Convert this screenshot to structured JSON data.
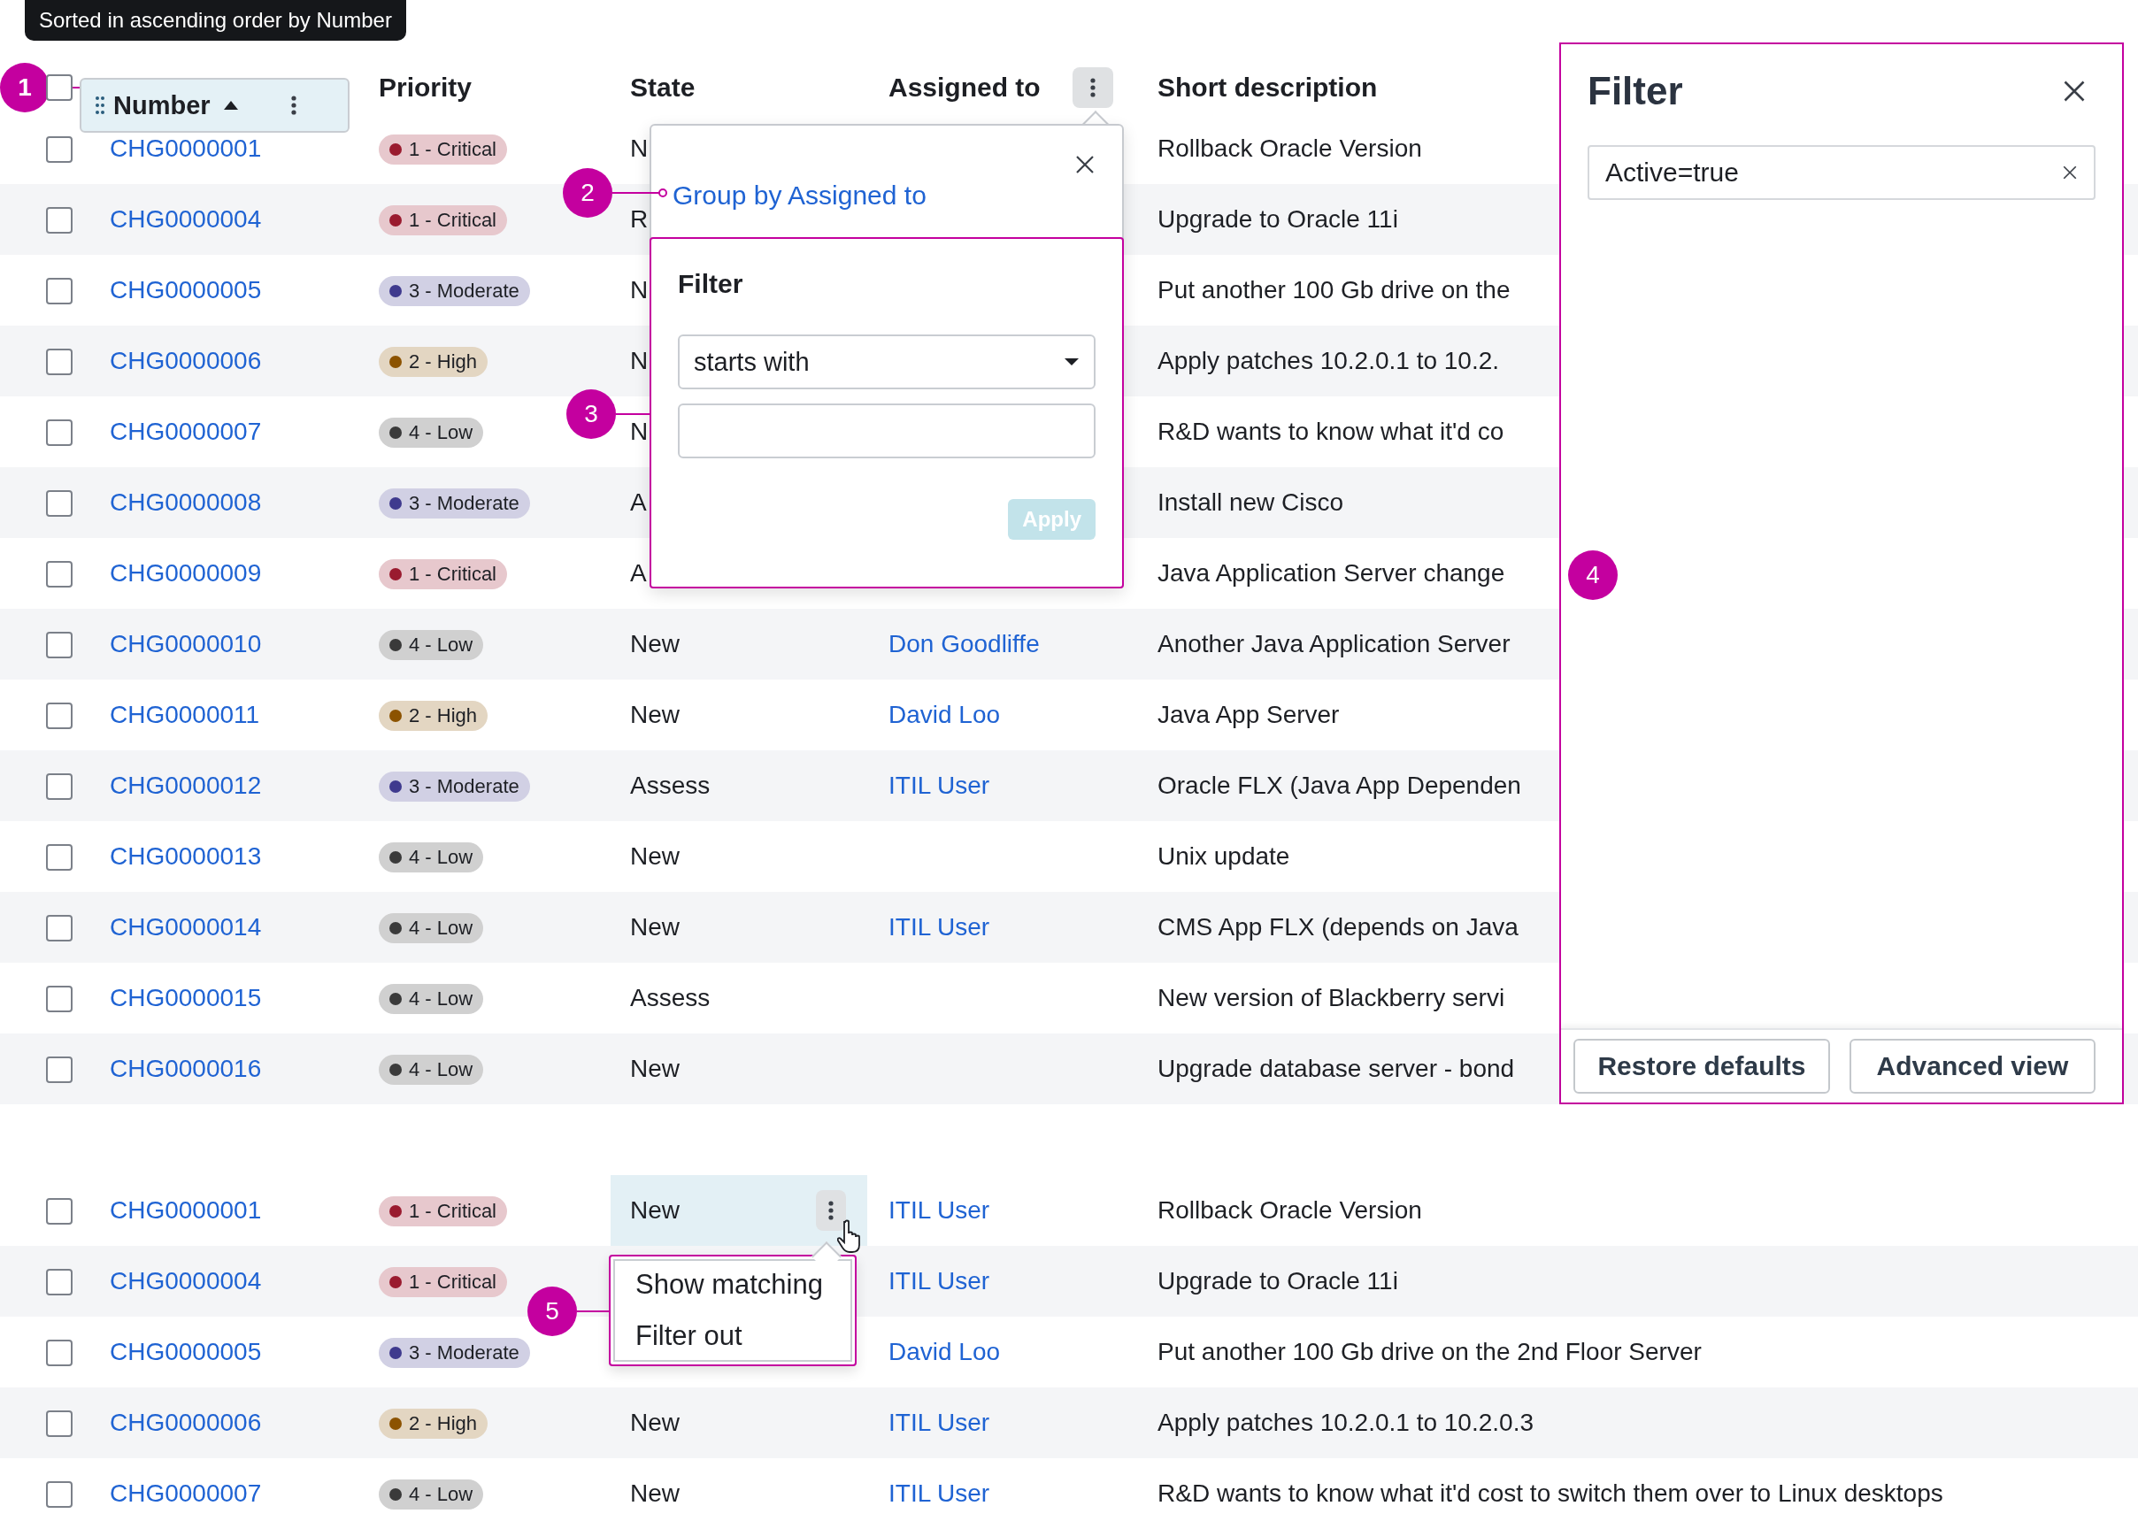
{
  "tooltip": "Sorted in ascending order by Number",
  "header": {
    "checked": false,
    "columns": [
      {
        "label": "Number",
        "selected": true,
        "sort_ascending": true,
        "menu_open": false,
        "annotation": "1"
      },
      {
        "label": "Priority"
      },
      {
        "label": "State"
      },
      {
        "label": "Assigned to",
        "menu_open": true
      },
      {
        "label": "Short description"
      }
    ]
  },
  "tables": [
    {
      "rows": [
        {
          "checked": false,
          "number": "CHG0000001",
          "priority": {
            "label": "1 - Critical",
            "color": "#9a1b2f"
          },
          "state": "N",
          "short_description": "Rollback Oracle Version"
        },
        {
          "checked": false,
          "number": "CHG0000004",
          "priority": {
            "label": "1 - Critical",
            "color": "#9a1b2f"
          },
          "state": "R",
          "short_description": "Upgrade to Oracle 11i"
        },
        {
          "checked": false,
          "number": "CHG0000005",
          "priority": {
            "label": "3 - Moderate",
            "color": "#3f3a8e"
          },
          "state": "N",
          "short_description": "Put another 100 Gb drive on the"
        },
        {
          "checked": false,
          "number": "CHG0000006",
          "priority": {
            "label": "2 - High",
            "color": "#8c5300"
          },
          "state": "N",
          "short_description": "Apply patches 10.2.0.1 to 10.2."
        },
        {
          "checked": false,
          "number": "CHG0000007",
          "priority": {
            "label": "4 - Low",
            "color": "#3a3a3a"
          },
          "state": "N",
          "short_description": "R&D wants to know what it'd co"
        },
        {
          "checked": false,
          "number": "CHG0000008",
          "priority": {
            "label": "3 - Moderate",
            "color": "#3f3a8e"
          },
          "state": "A",
          "short_description": "Install new Cisco"
        },
        {
          "checked": false,
          "number": "CHG0000009",
          "priority": {
            "label": "1 - Critical",
            "color": "#9a1b2f"
          },
          "state": "A",
          "short_description": "Java Application Server change"
        },
        {
          "checked": false,
          "number": "CHG0000010",
          "priority": {
            "label": "4 - Low",
            "color": "#3a3a3a"
          },
          "state": "New",
          "assigned_to": "Don Goodliffe",
          "short_description": "Another Java Application Server"
        },
        {
          "checked": false,
          "number": "CHG0000011",
          "priority": {
            "label": "2 - High",
            "color": "#8c5300"
          },
          "state": "New",
          "assigned_to": "David Loo",
          "short_description": "Java App Server"
        },
        {
          "checked": false,
          "number": "CHG0000012",
          "priority": {
            "label": "3 - Moderate",
            "color": "#3f3a8e"
          },
          "state": "Assess",
          "assigned_to": "ITIL User",
          "short_description": "Oracle FLX (Java App Dependen"
        },
        {
          "checked": false,
          "number": "CHG0000013",
          "priority": {
            "label": "4 - Low",
            "color": "#3a3a3a"
          },
          "state": "New",
          "short_description": "Unix update"
        },
        {
          "checked": false,
          "number": "CHG0000014",
          "priority": {
            "label": "4 - Low",
            "color": "#3a3a3a"
          },
          "state": "New",
          "assigned_to": "ITIL User",
          "short_description": "CMS App FLX (depends on Java"
        },
        {
          "checked": false,
          "number": "CHG0000015",
          "priority": {
            "label": "4 - Low",
            "color": "#3a3a3a"
          },
          "state": "Assess",
          "short_description": "New version of Blackberry servi"
        },
        {
          "checked": false,
          "number": "CHG0000016",
          "priority": {
            "label": "4 - Low",
            "color": "#3a3a3a"
          },
          "state": "New",
          "short_description": "Upgrade database server - bond"
        }
      ]
    },
    {
      "rows": [
        {
          "checked": false,
          "number": "CHG0000001",
          "priority": {
            "label": "1 - Critical",
            "color": "#9a1b2f"
          },
          "state": "New",
          "hovered": true,
          "assigned_to": "ITIL User",
          "short_description": "Rollback Oracle Version"
        },
        {
          "checked": false,
          "number": "CHG0000004",
          "priority": {
            "label": "1 - Critical",
            "color": "#9a1b2f"
          },
          "hovered": false,
          "assigned_to": "ITIL User",
          "short_description": "Upgrade to Oracle 11i"
        },
        {
          "checked": false,
          "number": "CHG0000005",
          "priority": {
            "label": "3 - Moderate",
            "color": "#3f3a8e"
          },
          "hovered": false,
          "assigned_to": "David Loo",
          "short_description": "Put another 100 Gb drive on the 2nd Floor Server"
        },
        {
          "checked": false,
          "number": "CHG0000006",
          "priority": {
            "label": "2 - High",
            "color": "#8c5300"
          },
          "state": "New",
          "hovered": false,
          "assigned_to": "ITIL User",
          "short_description": "Apply patches 10.2.0.1 to 10.2.0.3"
        },
        {
          "checked": false,
          "number": "CHG0000007",
          "priority": {
            "label": "4 - Low",
            "color": "#3a3a3a"
          },
          "state": "New",
          "hovered": false,
          "assigned_to": "ITIL User",
          "short_description": "R&D wants to know what it'd cost to switch them over to Linux desktops"
        }
      ]
    }
  ],
  "column_popover": {
    "group_by": "Group by Assigned to",
    "annotation": "2",
    "filter": {
      "title": "Filter",
      "operator": "starts with",
      "apply": {
        "label": "Apply",
        "disabled": true
      },
      "annotation": "3"
    }
  },
  "filter_panel": {
    "title": "Filter",
    "conditions": [
      "Active=true"
    ],
    "buttons": [
      "Restore defaults",
      "Advanced view"
    ],
    "annotation": "4"
  },
  "cell_menu": {
    "items": [
      "Show matching",
      "Filter out"
    ],
    "annotation": "5"
  }
}
